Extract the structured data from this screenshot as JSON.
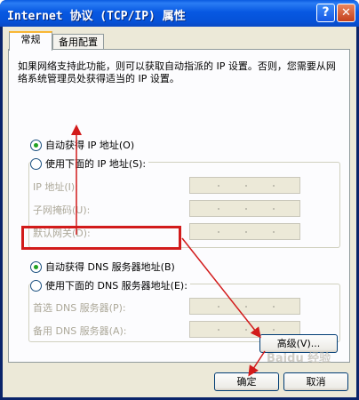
{
  "window": {
    "title": "Internet 协议 (TCP/IP) 属性",
    "help_glyph": "?",
    "close_glyph": "✕"
  },
  "tabs": [
    {
      "label": "常规",
      "active": true
    },
    {
      "label": "备用配置",
      "active": false
    }
  ],
  "description": "如果网络支持此功能，则可以获取自动指派的 IP 设置。否则，您需要从网络系统管理员处获得适当的 IP 设置。",
  "ip_section": {
    "auto_label": "自动获得 IP 地址(O)",
    "manual_label": "使用下面的 IP 地址(S):",
    "selected": "auto",
    "fields": [
      {
        "label": "IP 地址(I):"
      },
      {
        "label": "子网掩码(U):"
      },
      {
        "label": "默认网关(D):"
      }
    ]
  },
  "dns_section": {
    "auto_label": "自动获得 DNS 服务器地址(B)",
    "manual_label": "使用下面的 DNS 服务器地址(E):",
    "selected": "auto",
    "fields": [
      {
        "label": "首选 DNS 服务器(P):"
      },
      {
        "label": "备用 DNS 服务器(A):"
      }
    ]
  },
  "buttons": {
    "advanced": "高级(V)...",
    "ok": "确定",
    "cancel": "取消"
  },
  "annotation": {
    "color": "#d21b1b"
  },
  "watermark": "Baidu 经验"
}
